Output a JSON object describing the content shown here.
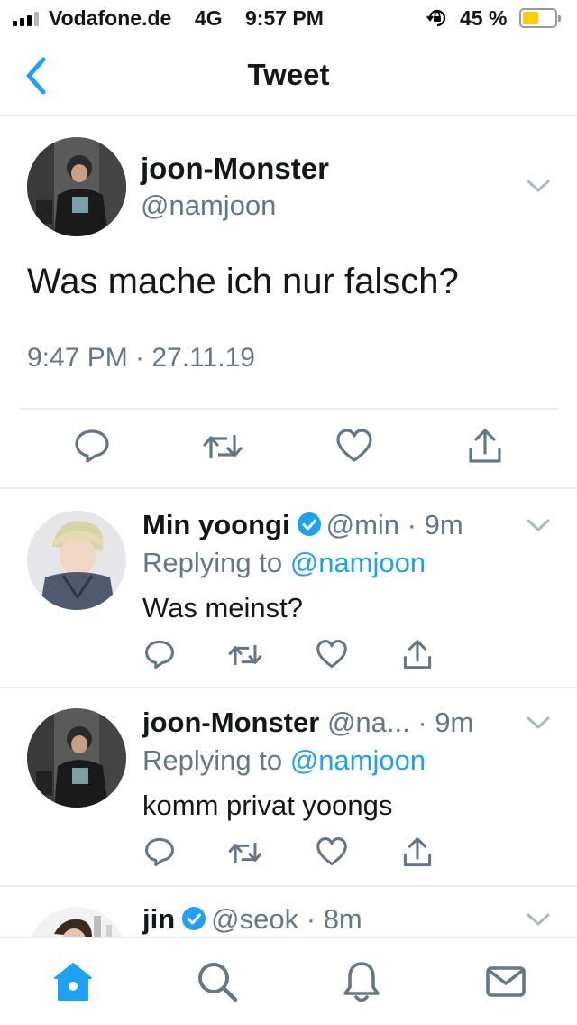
{
  "status_bar": {
    "carrier": "Vodafone.de",
    "network": "4G",
    "time": "9:57 PM",
    "battery_percent": "45 %",
    "battery_level": 0.45,
    "signal_bars_on": 3,
    "signal_bars_total": 4,
    "icons": [
      "signal-icon",
      "orientation-lock-icon",
      "battery-icon"
    ]
  },
  "header": {
    "back_icon": "chevron-left-icon",
    "title": "Tweet"
  },
  "main_tweet": {
    "display_name": "joon-Monster",
    "handle": "@namjoon",
    "text": "Was mache ich nur falsch?",
    "timestamp": "9:47 PM · 27.11.19",
    "actions": [
      "reply-icon",
      "retweet-icon",
      "like-icon",
      "share-icon"
    ]
  },
  "replies": [
    {
      "display_name": "Min yoongi",
      "verified": true,
      "handle": "@min",
      "time": "9m",
      "replying_prefix": "Replying to ",
      "replying_to": "@namjoon",
      "text": "Was meinst?"
    },
    {
      "display_name": "joon-Monster",
      "verified": false,
      "handle": "@na...",
      "time": "9m",
      "replying_prefix": "Replying to ",
      "replying_to": "@namjoon",
      "text": "komm privat yoongs"
    },
    {
      "display_name": "jin",
      "verified": true,
      "handle": "@seok",
      "time": "8m"
    }
  ],
  "separator": "·",
  "tab_bar": {
    "tabs": [
      "home-icon",
      "search-icon",
      "notifications-icon",
      "messages-icon"
    ],
    "active": "home-icon"
  },
  "colors": {
    "accent": "#1da1f2",
    "text_primary": "#14171a",
    "text_secondary": "#657786",
    "divider": "#e6ecf0",
    "battery_fill": "#ffcc00"
  }
}
